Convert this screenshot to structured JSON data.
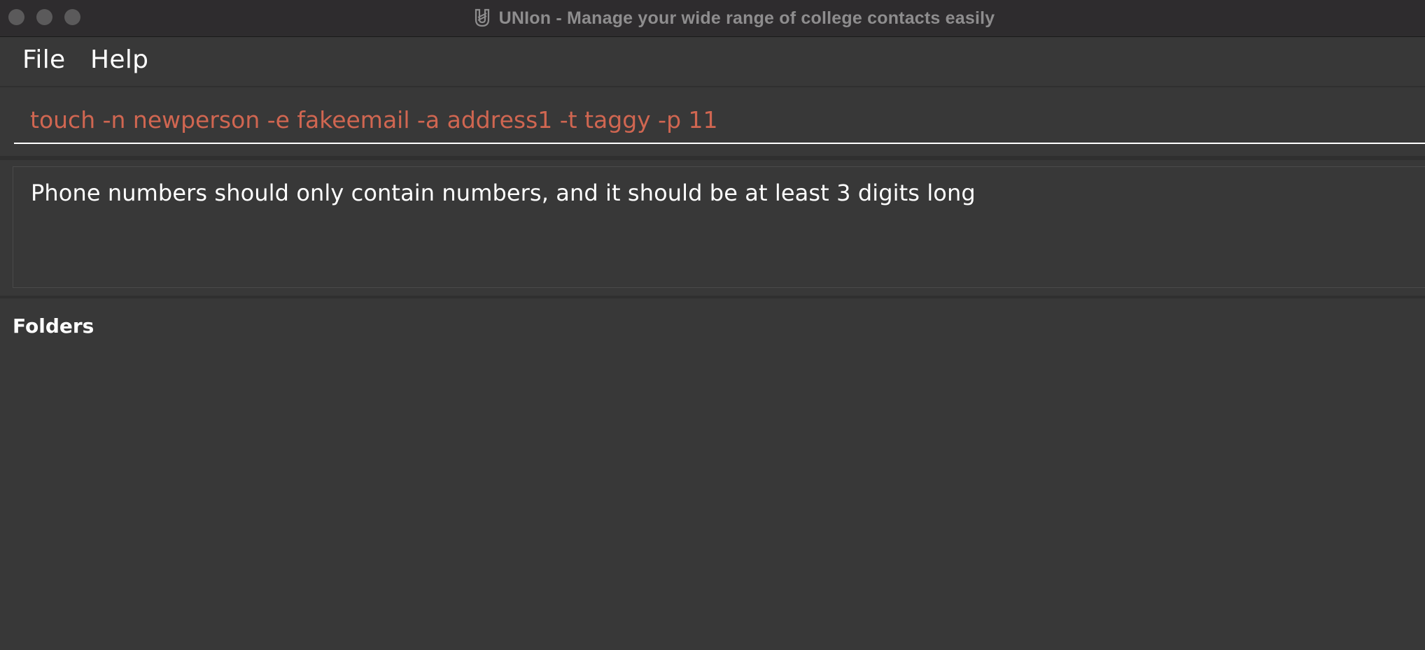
{
  "window": {
    "title": "UNIon - Manage your wide range of college contacts easily",
    "icon": "app-logo-icon"
  },
  "menubar": {
    "items": [
      {
        "label": "File"
      },
      {
        "label": "Help"
      }
    ]
  },
  "command": {
    "value": "touch -n newperson -e fakeemail -a address1 -t taggy -p 11",
    "text_color": "#d06651"
  },
  "result": {
    "message": "Phone numbers should only contain numbers, and it should be at least 3 digits long"
  },
  "folders": {
    "heading": "Folders",
    "items": []
  },
  "colors": {
    "background": "#383838",
    "titlebar": "#2e2c2e",
    "error_text": "#d06651",
    "text": "#ffffff"
  }
}
